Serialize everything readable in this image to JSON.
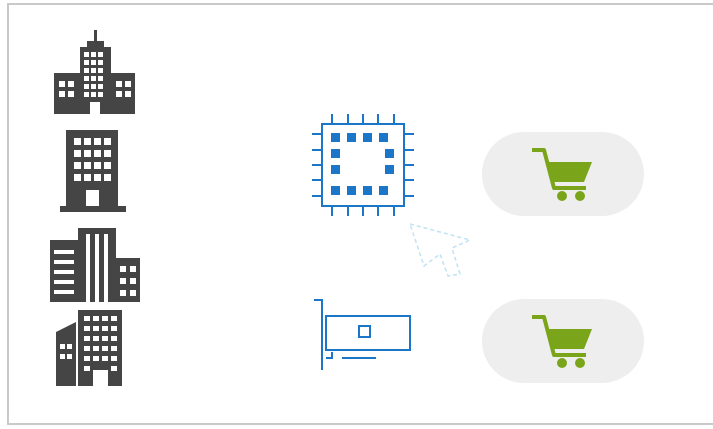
{
  "colors": {
    "frame_border": "#c9c9c9",
    "building": "#454545",
    "window": "#ffffff",
    "chip": "#1b76c8",
    "card": "#1b76c8",
    "cursor": "#bfe3f5",
    "cart": "#7aa51a",
    "pill": "#eeeeee"
  },
  "icons": {
    "buildings": [
      "skyscraper-cluster-icon",
      "office-tower-icon",
      "office-block-icon",
      "apartment-building-icon"
    ],
    "processor": "cpu-chip-icon",
    "expansion_card": "network-card-icon",
    "pointer": "mouse-pointer-icon",
    "cart": "shopping-cart-icon"
  },
  "cart_buttons": [
    {
      "name": "cart-button-cpu",
      "icon": "shopping-cart-icon"
    },
    {
      "name": "cart-button-card",
      "icon": "shopping-cart-icon"
    }
  ]
}
